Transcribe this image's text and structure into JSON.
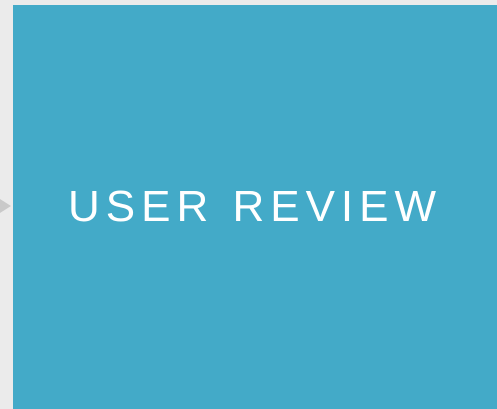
{
  "colors": {
    "background": "#ebebeb",
    "card": "#43aac8",
    "title_text": "#ffffff",
    "arrow": "#c9c9c9"
  },
  "icons": {
    "connector": "arrow-right-icon"
  },
  "card": {
    "title": "USER REVIEW"
  }
}
